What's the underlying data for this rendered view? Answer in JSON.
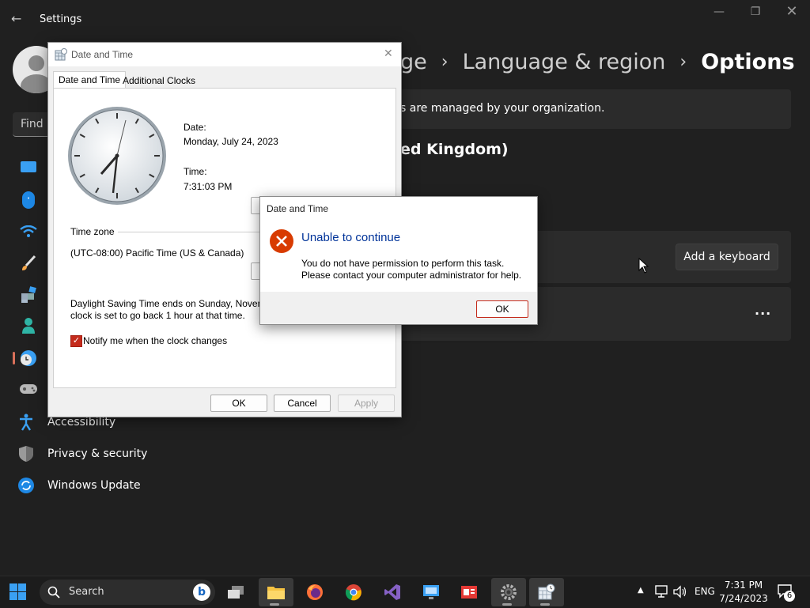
{
  "settings": {
    "title": "Settings",
    "breadcrumb": {
      "part1": "ge",
      "part2": "Language & region",
      "current": "Options"
    },
    "managed_notice": "s are managed by your organization.",
    "language_heading": "ed Kingdom)",
    "add_keyboard_label": "Add a keyboard",
    "more_label": "...",
    "search_placeholder": "Find a",
    "sidebar": {
      "accessibility": "Accessibility",
      "privacy": "Privacy & security",
      "update": "Windows Update"
    }
  },
  "datetime_dialog": {
    "title": "Date and Time",
    "tabs": [
      "Date and Time",
      "Additional Clocks"
    ],
    "date_label": "Date:",
    "date_value": "Monday, July 24, 2023",
    "time_label": "Time:",
    "time_value": "7:31:03 PM",
    "timezone_label": "Time zone",
    "timezone_value": "(UTC-08:00) Pacific Time (US & Canada)",
    "dst_line1": "Daylight Saving Time ends on Sunday, Novem",
    "dst_line2": "clock is set to go back 1 hour at that time.",
    "notify_label": "Notify me when the clock changes",
    "notify_checked": true,
    "ok_label": "OK",
    "cancel_label": "Cancel",
    "apply_label": "Apply"
  },
  "error_dialog": {
    "title": "Date and Time",
    "heading": "Unable to continue",
    "line1": "You do not have permission to perform this task.",
    "line2": "Please contact your computer administrator for help.",
    "ok_label": "OK"
  },
  "taskbar": {
    "search_label": "Search",
    "lang": "ENG",
    "time": "7:31 PM",
    "date": "7/24/2023",
    "notif_count": "6"
  },
  "colors": {
    "accent_red": "#d83b01",
    "link_blue": "#0067c0",
    "heading_blue": "#003399"
  }
}
